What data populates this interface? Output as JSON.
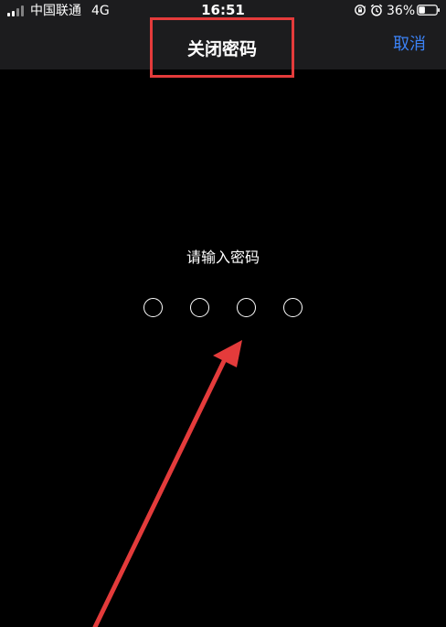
{
  "status_bar": {
    "carrier": "中国联通",
    "network": "4G",
    "time": "16:51",
    "battery": "36%",
    "battery_level": 0.36,
    "icons": [
      "signal-icon",
      "rotate-lock-icon",
      "alarm-icon",
      "battery-icon"
    ]
  },
  "nav": {
    "title": "关闭密码",
    "cancel_label": "取消"
  },
  "passcode": {
    "prompt": "请输入密码",
    "digit_count": 4,
    "filled_count": 0
  },
  "colors": {
    "background": "#000000",
    "header_background": "#1c1c1e",
    "accent": "#3b82f6",
    "annotation_red": "#e43b3b",
    "text": "#ffffff"
  }
}
